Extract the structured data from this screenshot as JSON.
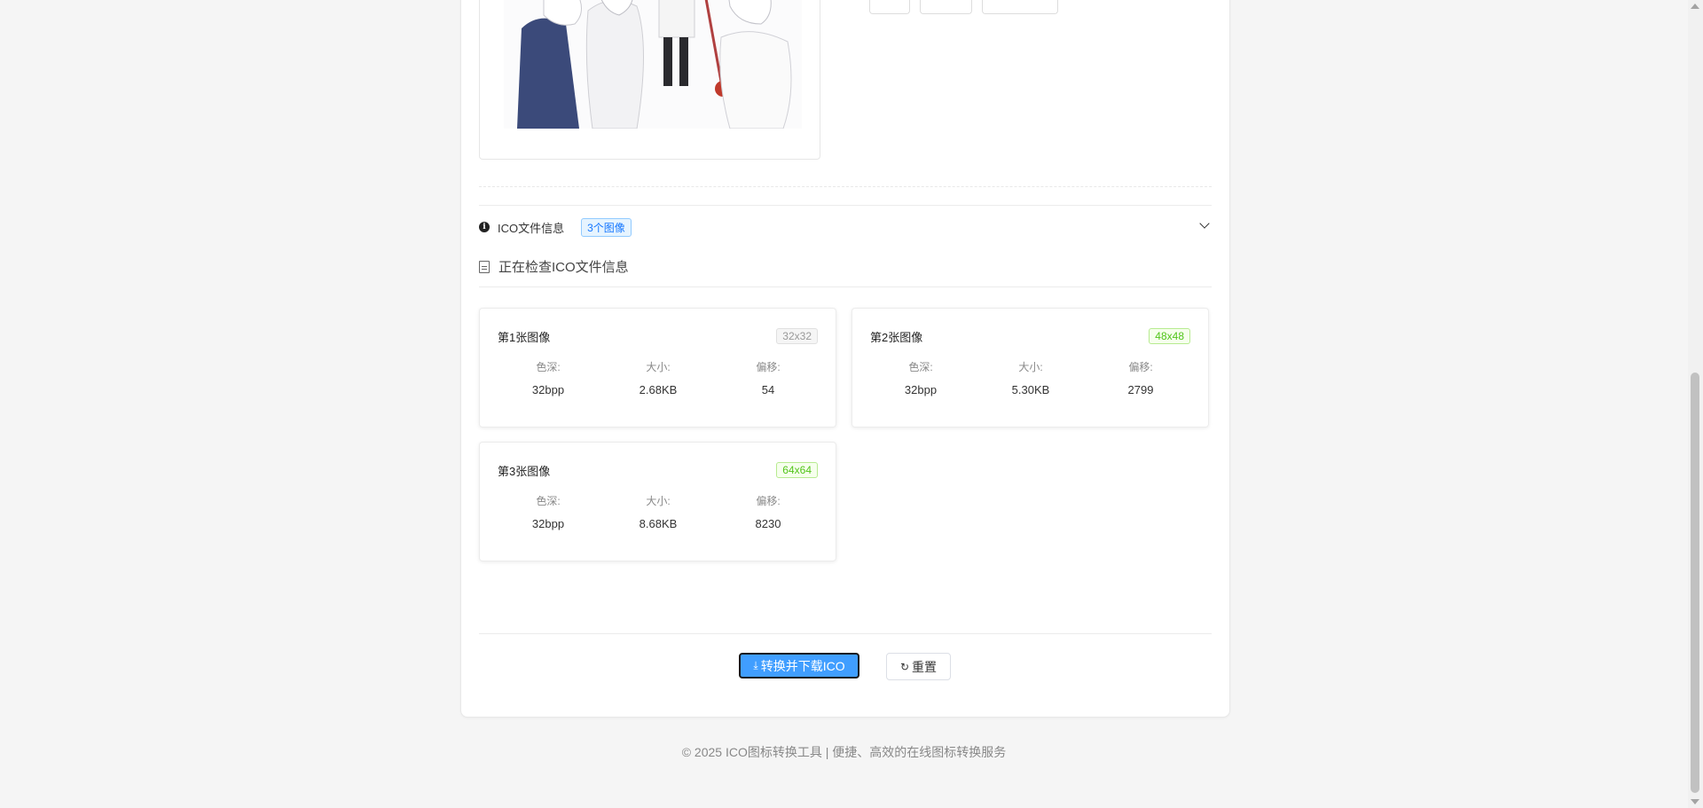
{
  "info_section": {
    "title": "ICO文件信息",
    "badge": "3个图像",
    "status": "正在检查ICO文件信息"
  },
  "images": [
    {
      "title": "第1张图像",
      "size": "32x32",
      "labels": {
        "depth": "色深:",
        "size": "大小:",
        "offset": "偏移:"
      },
      "depth": "32bpp",
      "filesize": "2.68KB",
      "offset": "54"
    },
    {
      "title": "第2张图像",
      "size": "48x48",
      "labels": {
        "depth": "色深:",
        "size": "大小:",
        "offset": "偏移:"
      },
      "depth": "32bpp",
      "filesize": "5.30KB",
      "offset": "2799"
    },
    {
      "title": "第3张图像",
      "size": "64x64",
      "labels": {
        "depth": "色深:",
        "size": "大小:",
        "offset": "偏移:"
      },
      "depth": "32bpp",
      "filesize": "8.68KB",
      "offset": "8230"
    }
  ],
  "actions": {
    "convert_label": "转换并下载ICO",
    "reset_label": "重置"
  },
  "footer": {
    "text": "© 2025 ICO图标转换工具 | 便捷、高效的在线图标转换服务"
  },
  "colors": {
    "primary": "#409eff",
    "info_badge": "#1677ff",
    "size_badge_green": "#52c41a"
  }
}
